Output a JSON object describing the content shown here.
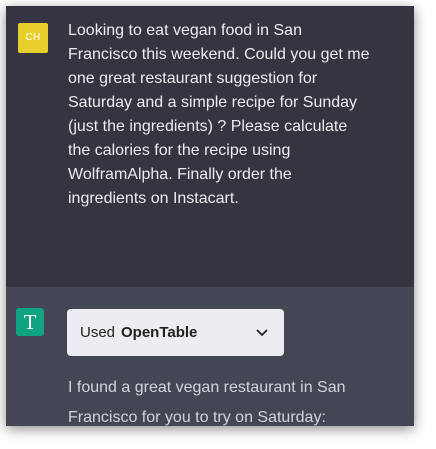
{
  "colors": {
    "user_bg": "#343541",
    "assistant_bg": "#444654",
    "user_avatar": "#e8cf2b",
    "assistant_avatar": "#10a37f",
    "pill_bg": "#ececf1"
  },
  "user_message": {
    "avatar_initials": "CH",
    "lines": [
      "Looking to eat vegan food in San",
      "Francisco this weekend. Could you get me",
      "one great restaurant suggestion for",
      "Saturday and a simple recipe for Sunday",
      "(just the ingredients) ? Please calculate",
      "the calories for the recipe using",
      "WolframAlpha. Finally order the",
      "ingredients on Instacart."
    ]
  },
  "assistant_message": {
    "avatar_letter": "T",
    "plugin": {
      "used_label": "Used",
      "plugin_name": "OpenTable",
      "icon": "chevron-down-icon"
    },
    "lines": [
      "I found a great vegan restaurant in San",
      "Francisco for you to try on Saturday:"
    ]
  }
}
